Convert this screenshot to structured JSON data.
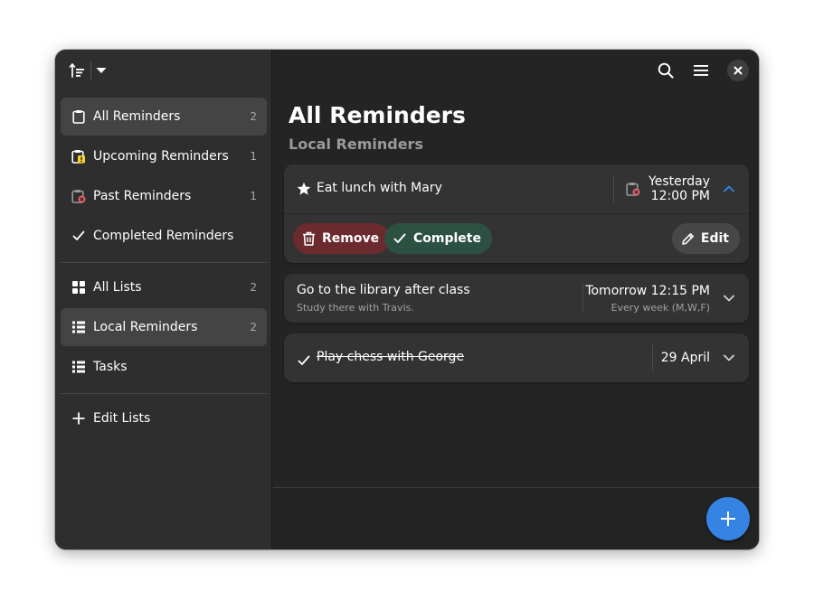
{
  "colors": {
    "window_bg": "#242424",
    "sidebar_bg": "#2e2e2e",
    "accent": "#3584e4",
    "remove_pill": "#6b2a2e",
    "complete_pill": "#2c5142",
    "warning_badge": "#f6d32d",
    "error_badge": "#e66161"
  },
  "header": {
    "sort_icon": "sort-ascending-icon",
    "sort_dropdown_icon": "pan-down-icon",
    "search_icon": "search-icon",
    "menu_icon": "hamburger-menu-icon",
    "close_icon": "close-icon"
  },
  "sidebar": {
    "reminder_views": [
      {
        "label": "All Reminders",
        "count": "2",
        "icon": "clipboard-icon",
        "selected": true
      },
      {
        "label": "Upcoming Reminders",
        "count": "1",
        "icon": "clipboard-warning-icon"
      },
      {
        "label": "Past Reminders",
        "count": "1",
        "icon": "clipboard-error-icon"
      },
      {
        "label": "Completed Reminders",
        "count": "",
        "icon": "checkmark-icon"
      }
    ],
    "lists": [
      {
        "label": "All Lists",
        "count": "2",
        "icon": "grid-icon"
      },
      {
        "label": "Local Reminders",
        "count": "2",
        "icon": "list-icon",
        "selected": true
      },
      {
        "label": "Tasks",
        "count": "",
        "icon": "list-icon"
      }
    ],
    "edit_lists": {
      "label": "Edit Lists",
      "icon": "plus-icon"
    }
  },
  "main": {
    "title": "All Reminders",
    "subtitle": "Local Reminders",
    "reminders": [
      {
        "title": "Eat lunch with Mary",
        "icon": "star-icon",
        "date_line1": "Yesterday",
        "date_line2": "12:00 PM",
        "status_icon": "clipboard-error-icon",
        "expanded": true,
        "chevron_icon": "chevron-up-icon",
        "actions": {
          "remove": "Remove",
          "complete": "Complete",
          "edit": "Edit"
        }
      },
      {
        "title": "Go to the library after class",
        "notes": "Study there with Travis.",
        "date": "Tomorrow 12:15 PM",
        "repeat": "Every week (M,W,F)",
        "chevron_icon": "chevron-down-icon"
      },
      {
        "title": "Play chess with George",
        "completed": true,
        "icon": "checkmark-icon",
        "date": "29 April",
        "chevron_icon": "chevron-down-icon"
      }
    ]
  },
  "fab": {
    "icon": "plus-icon"
  }
}
